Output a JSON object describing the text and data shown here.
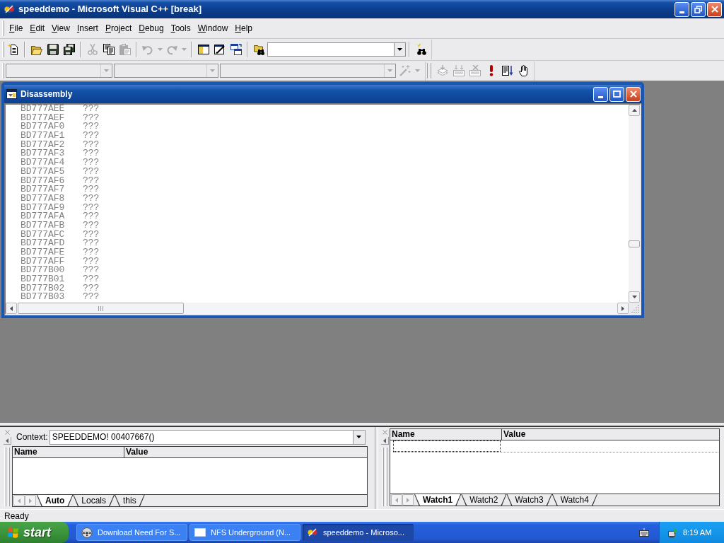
{
  "window": {
    "title": "speeddemo - Microsoft Visual C++ [break]"
  },
  "menu": [
    "File",
    "Edit",
    "View",
    "Insert",
    "Project",
    "Debug",
    "Tools",
    "Window",
    "Help"
  ],
  "standard_toolbar": [
    {
      "kind": "button",
      "disabled": false
    },
    {
      "kind": "separator"
    },
    {
      "kind": "button",
      "disabled": false
    },
    {
      "kind": "button",
      "disabled": false
    },
    {
      "kind": "button",
      "disabled": false
    },
    {
      "kind": "separator"
    },
    {
      "kind": "button",
      "disabled": true
    },
    {
      "kind": "button",
      "disabled": false
    },
    {
      "kind": "button",
      "disabled": true
    },
    {
      "kind": "separator"
    },
    {
      "kind": "split",
      "disabled": true
    },
    {
      "kind": "split",
      "disabled": true
    },
    {
      "kind": "separator"
    },
    {
      "kind": "button",
      "disabled": false
    },
    {
      "kind": "button",
      "disabled": false
    },
    {
      "kind": "button",
      "disabled": false
    },
    {
      "kind": "separator"
    },
    {
      "kind": "button",
      "disabled": false
    },
    {
      "kind": "combo",
      "disabled": false
    },
    {
      "kind": "separator"
    },
    {
      "kind": "button",
      "disabled": false
    }
  ],
  "wizard_bar": [
    {
      "kind": "combo",
      "disabled": true
    },
    {
      "kind": "combo",
      "disabled": true
    },
    {
      "kind": "combo",
      "disabled": true
    },
    {
      "kind": "split",
      "disabled": true
    }
  ],
  "build_minibar": [
    {
      "kind": "button",
      "disabled": true
    },
    {
      "kind": "button",
      "disabled": true
    },
    {
      "kind": "button",
      "disabled": true
    },
    {
      "kind": "button",
      "disabled": false
    },
    {
      "kind": "button",
      "disabled": false
    },
    {
      "kind": "button",
      "disabled": false
    }
  ],
  "disassembly": {
    "title": "Disassembly",
    "lines": [
      {
        "address": "BD777AEE",
        "code": "???"
      },
      {
        "address": "BD777AEF",
        "code": "???"
      },
      {
        "address": "BD777AF0",
        "code": "???"
      },
      {
        "address": "BD777AF1",
        "code": "???"
      },
      {
        "address": "BD777AF2",
        "code": "???"
      },
      {
        "address": "BD777AF3",
        "code": "???"
      },
      {
        "address": "BD777AF4",
        "code": "???"
      },
      {
        "address": "BD777AF5",
        "code": "???"
      },
      {
        "address": "BD777AF6",
        "code": "???"
      },
      {
        "address": "BD777AF7",
        "code": "???"
      },
      {
        "address": "BD777AF8",
        "code": "???"
      },
      {
        "address": "BD777AF9",
        "code": "???"
      },
      {
        "address": "BD777AFA",
        "code": "???"
      },
      {
        "address": "BD777AFB",
        "code": "???"
      },
      {
        "address": "BD777AFC",
        "code": "???"
      },
      {
        "address": "BD777AFD",
        "code": "???"
      },
      {
        "address": "BD777AFE",
        "code": "???"
      },
      {
        "address": "BD777AFF",
        "code": "???"
      },
      {
        "address": "BD777B00",
        "code": "???"
      },
      {
        "address": "BD777B01",
        "code": "???"
      },
      {
        "address": "BD777B02",
        "code": "???"
      },
      {
        "address": "BD777B03",
        "code": "???"
      }
    ]
  },
  "variables_pane": {
    "context_label": "Context:",
    "context_value": "SPEEDDEMO! 00407667()",
    "columns": [
      "Name",
      "Value"
    ],
    "tabs": [
      {
        "label": "Auto",
        "selected": true
      },
      {
        "label": "Locals",
        "selected": false
      },
      {
        "label": "this",
        "selected": false
      }
    ]
  },
  "watch_pane": {
    "columns": [
      "Name",
      "Value"
    ],
    "tabs": [
      {
        "label": "Watch1",
        "selected": true
      },
      {
        "label": "Watch2",
        "selected": false
      },
      {
        "label": "Watch3",
        "selected": false
      },
      {
        "label": "Watch4",
        "selected": false
      }
    ]
  },
  "status_bar": {
    "text": "Ready"
  },
  "taskbar": {
    "start_label": "start",
    "tasks": [
      {
        "label": "Download Need For S...",
        "selected": false
      },
      {
        "label": "NFS Underground (N...",
        "selected": false
      },
      {
        "label": "speeddemo - Microso...",
        "selected": true
      }
    ],
    "clock": "8:19 AM"
  }
}
